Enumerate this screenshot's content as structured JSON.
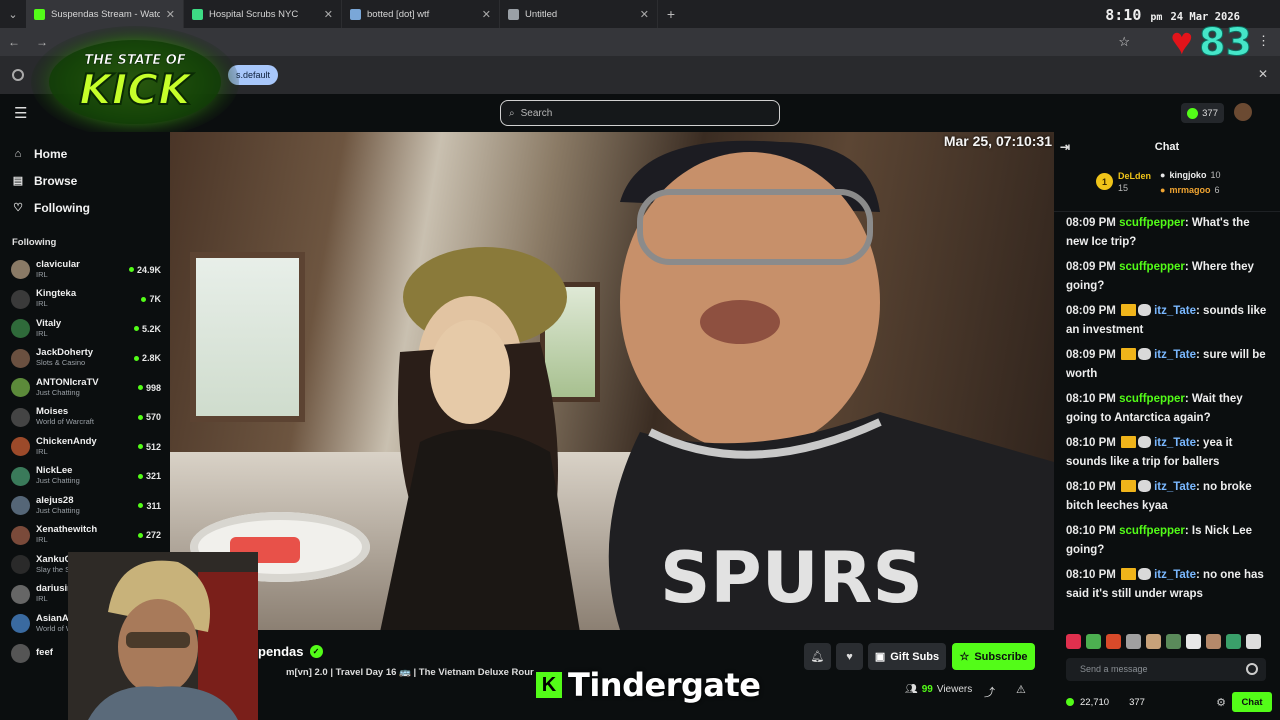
{
  "browser": {
    "tabs": [
      {
        "label": "Suspendas Stream - Watch",
        "favicon_color": "#53fc18",
        "active": true
      },
      {
        "label": "Hospital Scrubs NYC",
        "favicon_color": "#3ddc84",
        "active": false
      },
      {
        "label": "botted [dot] wtf",
        "favicon_color": "#7aa7d8",
        "active": false
      },
      {
        "label": "Untitled",
        "favicon_color": "#9aa0a6",
        "active": false
      }
    ],
    "new_tab_icon": "+",
    "clock_time": "8:10",
    "clock_suffix": "pm",
    "clock_date": "24 Mar 2026",
    "info_pill": "s.default"
  },
  "overlay": {
    "logo_text_top": "THE STATE OF",
    "logo_text_main": "KICK",
    "heart_count": "83"
  },
  "topnav": {
    "search_placeholder": "Search",
    "kick_balance": "377"
  },
  "sidebar": {
    "nav": [
      {
        "label": "Home",
        "icon": "home-icon",
        "glyph": "⌂"
      },
      {
        "label": "Browse",
        "icon": "browse-icon",
        "glyph": "▤"
      },
      {
        "label": "Following",
        "icon": "heart-icon",
        "glyph": "♡"
      }
    ],
    "following_header": "Following",
    "following": [
      {
        "name": "clavicular",
        "category": "IRL",
        "viewers": "24.9K",
        "color": "#8a7a66"
      },
      {
        "name": "Kingteka",
        "category": "IRL",
        "viewers": "7K",
        "color": "#3a3a3a"
      },
      {
        "name": "Vitaly",
        "category": "IRL",
        "viewers": "5.2K",
        "color": "#2f6a3a"
      },
      {
        "name": "JackDoherty",
        "category": "Slots & Casino",
        "viewers": "2.8K",
        "color": "#6a5040"
      },
      {
        "name": "ANTONIcraTV",
        "category": "Just Chatting",
        "viewers": "998",
        "color": "#5c8a3a"
      },
      {
        "name": "Moises",
        "category": "World of Warcraft",
        "viewers": "570",
        "color": "#444"
      },
      {
        "name": "ChickenAndy",
        "category": "IRL",
        "viewers": "512",
        "color": "#9c4a2a"
      },
      {
        "name": "NickLee",
        "category": "Just Chatting",
        "viewers": "321",
        "color": "#3a7a5a"
      },
      {
        "name": "alejus28",
        "category": "Just Chatting",
        "viewers": "311",
        "color": "#556677"
      },
      {
        "name": "Xenathewitch",
        "category": "IRL",
        "viewers": "272",
        "color": "#7a4a3a"
      },
      {
        "name": "XankuGaming",
        "category": "Slay the Spire II",
        "viewers": "",
        "color": "#2a2a2a"
      },
      {
        "name": "dariusirl",
        "category": "IRL",
        "viewers": "",
        "color": "#666"
      },
      {
        "name": "AsianAndy",
        "category": "World of W",
        "viewers": "",
        "color": "#3a6aa0"
      },
      {
        "name": "feef",
        "category": "",
        "viewers": "",
        "color": "#555"
      }
    ]
  },
  "stream": {
    "timestamp": "Mar 25, 07:10:31",
    "channel_name": "pendas",
    "title": "m[vn] 2.0 | Travel Day 16 🚌 | The Vietnam Deluxe Rour",
    "gift_label": "Gift Subs",
    "subscribe_label": "Subscribe",
    "viewers_count": "99",
    "viewers_label": "Viewers",
    "caption": "Tindergate"
  },
  "chat": {
    "header": "Chat",
    "leaderboard": {
      "first": {
        "rank": "1",
        "name": "DeLden",
        "count": "15"
      },
      "second": {
        "name": "kingjoko",
        "count": "10"
      },
      "third": {
        "name": "mrmagoo",
        "count": "6"
      }
    },
    "messages": [
      {
        "time": "08:09 PM",
        "user": "scuffpepper",
        "badges": false,
        "text": ": What's the new Ice trip?"
      },
      {
        "time": "08:09 PM",
        "user": "scuffpepper",
        "badges": false,
        "text": ": Where they going?"
      },
      {
        "time": "08:09 PM",
        "user": "itz_Tate",
        "badges": true,
        "text": ": sounds like an investment"
      },
      {
        "time": "08:09 PM",
        "user": "itz_Tate",
        "badges": true,
        "text": ": sure will be worth"
      },
      {
        "time": "08:10 PM",
        "user": "scuffpepper",
        "badges": false,
        "text": ": Wait they going to Antarctica again?"
      },
      {
        "time": "08:10 PM",
        "user": "itz_Tate",
        "badges": true,
        "text": ": yea it sounds like a trip for ballers"
      },
      {
        "time": "08:10 PM",
        "user": "itz_Tate",
        "badges": true,
        "text": ": no broke bitch leeches kyaa"
      },
      {
        "time": "08:10 PM",
        "user": "scuffpepper",
        "badges": false,
        "text": ": Is Nick Lee going?"
      },
      {
        "time": "08:10 PM",
        "user": "itz_Tate",
        "badges": true,
        "text": ": no one has said it's still under wraps"
      }
    ],
    "emote_colors": [
      "#e0304e",
      "#4caf50",
      "#d84a2a",
      "#a0a0a0",
      "#c8a27a",
      "#5a8a5a",
      "#e8e8e8",
      "#b5896a",
      "#3aa06a",
      "#ddd"
    ],
    "input_placeholder": "Send a message",
    "footer_points": "22,710",
    "footer_balance": "377",
    "chat_button": "Chat"
  }
}
